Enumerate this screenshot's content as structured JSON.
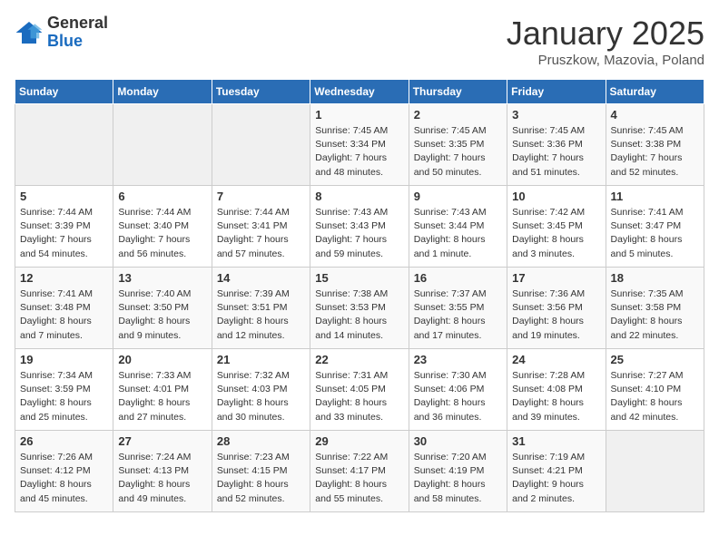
{
  "logo": {
    "general": "General",
    "blue": "Blue"
  },
  "header": {
    "month": "January 2025",
    "location": "Pruszkow, Mazovia, Poland"
  },
  "days_of_week": [
    "Sunday",
    "Monday",
    "Tuesday",
    "Wednesday",
    "Thursday",
    "Friday",
    "Saturday"
  ],
  "weeks": [
    [
      {
        "day": "",
        "info": ""
      },
      {
        "day": "",
        "info": ""
      },
      {
        "day": "",
        "info": ""
      },
      {
        "day": "1",
        "info": "Sunrise: 7:45 AM\nSunset: 3:34 PM\nDaylight: 7 hours and 48 minutes."
      },
      {
        "day": "2",
        "info": "Sunrise: 7:45 AM\nSunset: 3:35 PM\nDaylight: 7 hours and 50 minutes."
      },
      {
        "day": "3",
        "info": "Sunrise: 7:45 AM\nSunset: 3:36 PM\nDaylight: 7 hours and 51 minutes."
      },
      {
        "day": "4",
        "info": "Sunrise: 7:45 AM\nSunset: 3:38 PM\nDaylight: 7 hours and 52 minutes."
      }
    ],
    [
      {
        "day": "5",
        "info": "Sunrise: 7:44 AM\nSunset: 3:39 PM\nDaylight: 7 hours and 54 minutes."
      },
      {
        "day": "6",
        "info": "Sunrise: 7:44 AM\nSunset: 3:40 PM\nDaylight: 7 hours and 56 minutes."
      },
      {
        "day": "7",
        "info": "Sunrise: 7:44 AM\nSunset: 3:41 PM\nDaylight: 7 hours and 57 minutes."
      },
      {
        "day": "8",
        "info": "Sunrise: 7:43 AM\nSunset: 3:43 PM\nDaylight: 7 hours and 59 minutes."
      },
      {
        "day": "9",
        "info": "Sunrise: 7:43 AM\nSunset: 3:44 PM\nDaylight: 8 hours and 1 minute."
      },
      {
        "day": "10",
        "info": "Sunrise: 7:42 AM\nSunset: 3:45 PM\nDaylight: 8 hours and 3 minutes."
      },
      {
        "day": "11",
        "info": "Sunrise: 7:41 AM\nSunset: 3:47 PM\nDaylight: 8 hours and 5 minutes."
      }
    ],
    [
      {
        "day": "12",
        "info": "Sunrise: 7:41 AM\nSunset: 3:48 PM\nDaylight: 8 hours and 7 minutes."
      },
      {
        "day": "13",
        "info": "Sunrise: 7:40 AM\nSunset: 3:50 PM\nDaylight: 8 hours and 9 minutes."
      },
      {
        "day": "14",
        "info": "Sunrise: 7:39 AM\nSunset: 3:51 PM\nDaylight: 8 hours and 12 minutes."
      },
      {
        "day": "15",
        "info": "Sunrise: 7:38 AM\nSunset: 3:53 PM\nDaylight: 8 hours and 14 minutes."
      },
      {
        "day": "16",
        "info": "Sunrise: 7:37 AM\nSunset: 3:55 PM\nDaylight: 8 hours and 17 minutes."
      },
      {
        "day": "17",
        "info": "Sunrise: 7:36 AM\nSunset: 3:56 PM\nDaylight: 8 hours and 19 minutes."
      },
      {
        "day": "18",
        "info": "Sunrise: 7:35 AM\nSunset: 3:58 PM\nDaylight: 8 hours and 22 minutes."
      }
    ],
    [
      {
        "day": "19",
        "info": "Sunrise: 7:34 AM\nSunset: 3:59 PM\nDaylight: 8 hours and 25 minutes."
      },
      {
        "day": "20",
        "info": "Sunrise: 7:33 AM\nSunset: 4:01 PM\nDaylight: 8 hours and 27 minutes."
      },
      {
        "day": "21",
        "info": "Sunrise: 7:32 AM\nSunset: 4:03 PM\nDaylight: 8 hours and 30 minutes."
      },
      {
        "day": "22",
        "info": "Sunrise: 7:31 AM\nSunset: 4:05 PM\nDaylight: 8 hours and 33 minutes."
      },
      {
        "day": "23",
        "info": "Sunrise: 7:30 AM\nSunset: 4:06 PM\nDaylight: 8 hours and 36 minutes."
      },
      {
        "day": "24",
        "info": "Sunrise: 7:28 AM\nSunset: 4:08 PM\nDaylight: 8 hours and 39 minutes."
      },
      {
        "day": "25",
        "info": "Sunrise: 7:27 AM\nSunset: 4:10 PM\nDaylight: 8 hours and 42 minutes."
      }
    ],
    [
      {
        "day": "26",
        "info": "Sunrise: 7:26 AM\nSunset: 4:12 PM\nDaylight: 8 hours and 45 minutes."
      },
      {
        "day": "27",
        "info": "Sunrise: 7:24 AM\nSunset: 4:13 PM\nDaylight: 8 hours and 49 minutes."
      },
      {
        "day": "28",
        "info": "Sunrise: 7:23 AM\nSunset: 4:15 PM\nDaylight: 8 hours and 52 minutes."
      },
      {
        "day": "29",
        "info": "Sunrise: 7:22 AM\nSunset: 4:17 PM\nDaylight: 8 hours and 55 minutes."
      },
      {
        "day": "30",
        "info": "Sunrise: 7:20 AM\nSunset: 4:19 PM\nDaylight: 8 hours and 58 minutes."
      },
      {
        "day": "31",
        "info": "Sunrise: 7:19 AM\nSunset: 4:21 PM\nDaylight: 9 hours and 2 minutes."
      },
      {
        "day": "",
        "info": ""
      }
    ]
  ]
}
